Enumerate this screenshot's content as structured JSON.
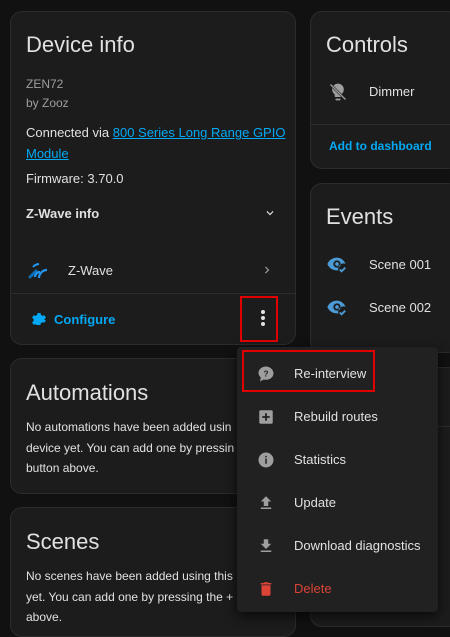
{
  "device_info": {
    "title": "Device info",
    "model": "ZEN72",
    "manufacturer": "by Zooz",
    "connected_prefix": "Connected via ",
    "connected_link": "800 Series Long Range GPIO Module",
    "connected_link_line1": "800 Series Long Range GPIO",
    "connected_link_line2": "Module",
    "firmware": "Firmware: 3.70.0",
    "zwave_info_label": "Z-Wave info",
    "integration_label": "Z-Wave",
    "configure_label": "Configure"
  },
  "automations": {
    "title": "Automations",
    "text_line1": "No automations have been added usin",
    "text_line2": "device yet. You can add one by pressin",
    "text_line3": "button above."
  },
  "scenes": {
    "title": "Scenes",
    "text_line1": "No scenes have been added using this",
    "text_line2": "yet. You can add one by pressing the +",
    "text_line3": "above."
  },
  "controls": {
    "title": "Controls",
    "entity_label": "Dimmer",
    "add_to_dashboard_label": "Add to dashboard"
  },
  "events": {
    "title": "Events",
    "items": [
      "Scene 001",
      "Scene 002"
    ]
  },
  "menu": {
    "items": [
      {
        "label": "Re-interview",
        "icon": "comment-question-icon"
      },
      {
        "label": "Rebuild routes",
        "icon": "plus-box-icon"
      },
      {
        "label": "Statistics",
        "icon": "info-circle-icon"
      },
      {
        "label": "Update",
        "icon": "upload-icon"
      },
      {
        "label": "Download diagnostics",
        "icon": "download-icon"
      },
      {
        "label": "Delete",
        "icon": "trash-icon"
      }
    ]
  },
  "colors": {
    "accent": "#03a9f4",
    "danger": "#db4437",
    "highlight": "#e00000",
    "background": "#111111",
    "card": "#1c1c1c"
  }
}
